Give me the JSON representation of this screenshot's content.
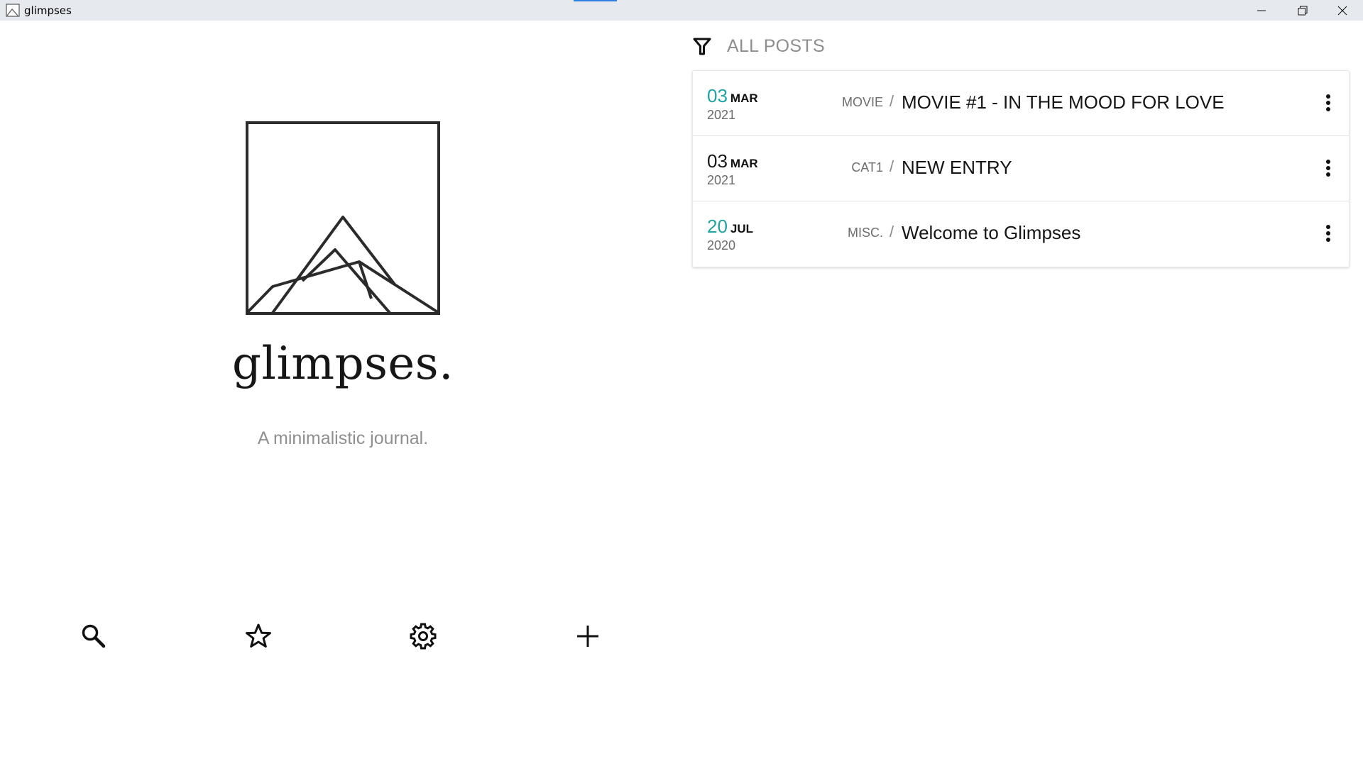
{
  "window": {
    "title": "glimpses"
  },
  "brand": {
    "name": "glimpses.",
    "tagline": "A minimalistic journal."
  },
  "colors": {
    "accent": "#1fa3a3",
    "text": "#161616",
    "muted": "#8e8e8e"
  },
  "toolbar": {
    "icons": [
      "search-icon",
      "star-icon",
      "gear-icon",
      "plus-icon"
    ]
  },
  "filter": {
    "label": "ALL POSTS"
  },
  "posts": [
    {
      "day": "03",
      "month": "MAR",
      "year": "2021",
      "category": "MOVIE",
      "separator": "/",
      "title": "MOVIE #1 - IN THE MOOD FOR LOVE",
      "day_highlighted": true
    },
    {
      "day": "03",
      "month": "MAR",
      "year": "2021",
      "category": "CAT1",
      "separator": "/",
      "title": "NEW ENTRY",
      "day_highlighted": false
    },
    {
      "day": "20",
      "month": "JUL",
      "year": "2020",
      "category": "MISC.",
      "separator": "/",
      "title": "Welcome to Glimpses",
      "day_highlighted": true
    }
  ]
}
